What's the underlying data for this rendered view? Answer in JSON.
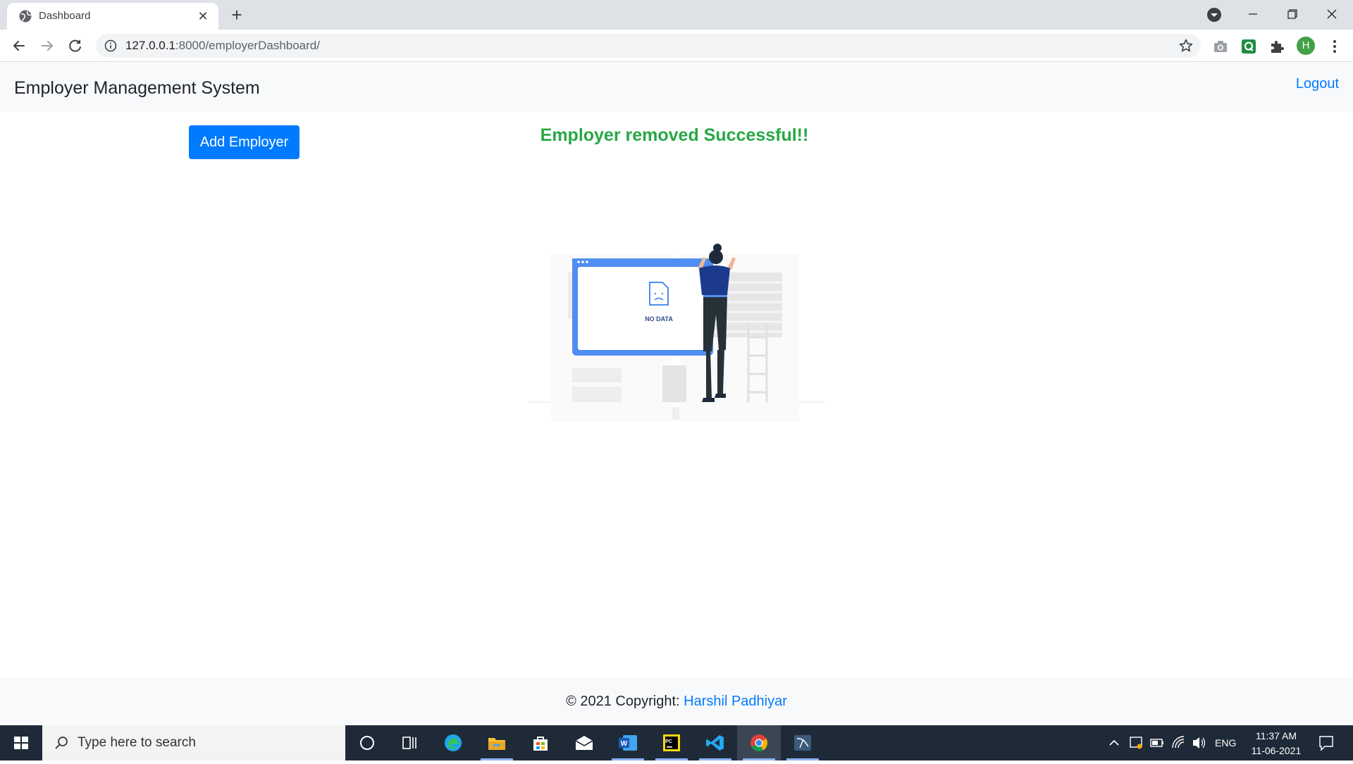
{
  "browser": {
    "tab_title": "Dashboard",
    "url_host": "127.0.0.1",
    "url_path": ":8000/employerDashboard/",
    "profile_initial": "H"
  },
  "page": {
    "brand": "Employer Management System",
    "logout_label": "Logout",
    "add_button_label": "Add Employer",
    "flash_message": "Employer removed Successful!!",
    "illustration_text": "NO DATA",
    "footer_prefix": "© 2021 Copyright: ",
    "footer_author": "Harshil Padhiyar"
  },
  "taskbar": {
    "search_placeholder": "Type here to search",
    "language": "ENG",
    "time": "11:37 AM",
    "date": "11-06-2021"
  },
  "colors": {
    "primary": "#007bff",
    "success": "#28a745",
    "taskbar": "#1f2a38"
  }
}
